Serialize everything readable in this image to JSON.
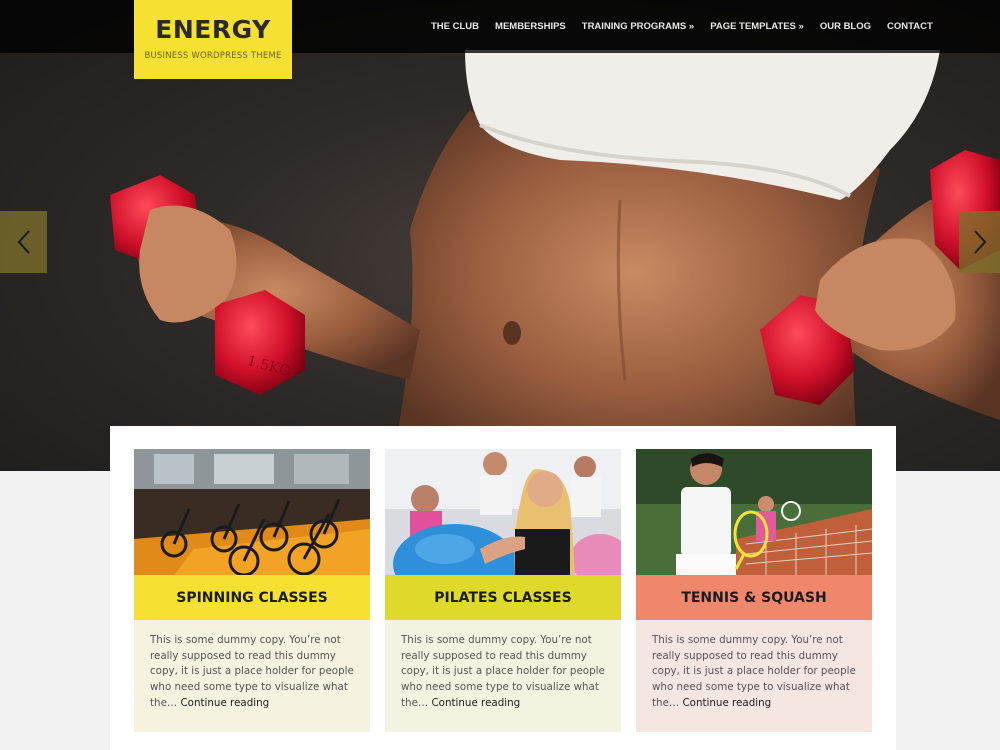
{
  "site": {
    "logo_title": "ENERGY",
    "logo_subtitle": "BUSINESS WORDPRESS THEME"
  },
  "nav": {
    "items": [
      {
        "label": "THE CLUB"
      },
      {
        "label": "MEMBERSHIPS"
      },
      {
        "label": "TRAINING PROGRAMS »"
      },
      {
        "label": "PAGE TEMPLATES »"
      },
      {
        "label": "OUR BLOG"
      },
      {
        "label": "CONTACT"
      }
    ]
  },
  "slider": {
    "prev_icon": "chevron-left-icon",
    "next_icon": "chevron-right-icon",
    "dumbbell_label": "1.5KG"
  },
  "cards": [
    {
      "title": "SPINNING CLASSES",
      "text": "This is some dummy copy. You’re not really supposed to read this dummy copy, it is just a place holder for people who need some type to visualize what the…",
      "more": "Continue reading",
      "title_color": "#f6e132",
      "body_color": "#f6f2e0"
    },
    {
      "title": "PILATES CLASSES",
      "text": "This is some dummy copy. You’re not really supposed to read this dummy copy, it is just a place holder for people who need some type to visualize what the…",
      "more": "Continue reading",
      "title_color": "#dfd92c",
      "body_color": "#f4f3e1"
    },
    {
      "title": "TENNIS & SQUASH",
      "text": "This is some dummy copy. You’re not really supposed to read this dummy copy, it is just a place holder for people who need some type to visualize what the…",
      "more": "Continue reading",
      "title_color": "#f0876a",
      "body_color": "#f6e6e2"
    }
  ],
  "colors": {
    "accent": "#f6e132",
    "topbar": "#000000",
    "page_bg": "#f2f2f2"
  }
}
